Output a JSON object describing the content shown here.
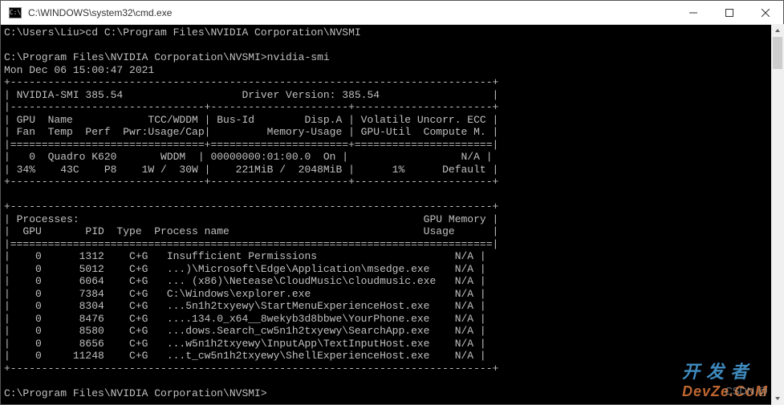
{
  "window": {
    "title": "C:\\WINDOWS\\system32\\cmd.exe"
  },
  "prompts": {
    "line1_path": "C:\\Users\\Liu>",
    "line1_cmd": "cd C:\\Program Files\\NVIDIA Corporation\\NVSMI",
    "line2_path": "C:\\Program Files\\NVIDIA Corporation\\NVSMI>",
    "line2_cmd": "nvidia-smi",
    "final_path": "C:\\Program Files\\NVIDIA Corporation\\NVSMI>"
  },
  "smi": {
    "timestamp": "Mon Dec 06 15:00:47 2021",
    "version_label": "NVIDIA-SMI 385.54",
    "driver_label": "Driver Version: 385.54",
    "header": {
      "col_gpu": "GPU",
      "col_name": "Name",
      "col_tccwddm": "TCC/WDDM",
      "col_fan": "Fan",
      "col_temp": "Temp",
      "col_perf": "Perf",
      "col_pwr": "Pwr:Usage/Cap",
      "col_busid": "Bus-Id",
      "col_dispa": "Disp.A",
      "col_memusage": "Memory-Usage",
      "col_volatile": "Volatile",
      "col_uncorr": "Uncorr. ECC",
      "col_gpuutil": "GPU-Util",
      "col_computem": "Compute M."
    },
    "gpu_row": {
      "idx": "0",
      "name": "Quadro K620",
      "mode": "WDDM",
      "busid": "00000000:01:00.0",
      "dispa": "On",
      "ecc": "N/A",
      "fan": "34%",
      "temp": "43C",
      "perf": "P8",
      "pwr_usage": "1W",
      "pwr_cap": "30W",
      "mem_used": "221MiB",
      "mem_total": "2048MiB",
      "util": "1%",
      "compute": "Default"
    },
    "proc_header": {
      "title": "Processes:",
      "mem": "GPU Memory",
      "gpu": "GPU",
      "pid": "PID",
      "type": "Type",
      "pname": "Process name",
      "usage": "Usage"
    },
    "processes": [
      {
        "gpu": "0",
        "pid": "1312",
        "type": "C+G",
        "name": "Insufficient Permissions",
        "mem": "N/A"
      },
      {
        "gpu": "0",
        "pid": "5012",
        "type": "C+G",
        "name": "...)\\Microsoft\\Edge\\Application\\msedge.exe",
        "mem": "N/A"
      },
      {
        "gpu": "0",
        "pid": "6064",
        "type": "C+G",
        "name": "... (x86)\\Netease\\CloudMusic\\cloudmusic.exe",
        "mem": "N/A"
      },
      {
        "gpu": "0",
        "pid": "7384",
        "type": "C+G",
        "name": "C:\\Windows\\explorer.exe",
        "mem": "N/A"
      },
      {
        "gpu": "0",
        "pid": "8304",
        "type": "C+G",
        "name": "...5n1h2txyewy\\StartMenuExperienceHost.exe",
        "mem": "N/A"
      },
      {
        "gpu": "0",
        "pid": "8476",
        "type": "C+G",
        "name": "....134.0_x64__8wekyb3d8bbwe\\YourPhone.exe",
        "mem": "N/A"
      },
      {
        "gpu": "0",
        "pid": "8580",
        "type": "C+G",
        "name": "...dows.Search_cw5n1h2txyewy\\SearchApp.exe",
        "mem": "N/A"
      },
      {
        "gpu": "0",
        "pid": "8656",
        "type": "C+G",
        "name": "...w5n1h2txyewy\\InputApp\\TextInputHost.exe",
        "mem": "N/A"
      },
      {
        "gpu": "0",
        "pid": "11248",
        "type": "C+G",
        "name": "...t_cw5n1h2txyewy\\ShellExperienceHost.exe",
        "mem": "N/A"
      }
    ]
  },
  "watermark": {
    "main": "开 发 者",
    "sub": "DevZe.CoM",
    "csdn": "CSDN @"
  }
}
